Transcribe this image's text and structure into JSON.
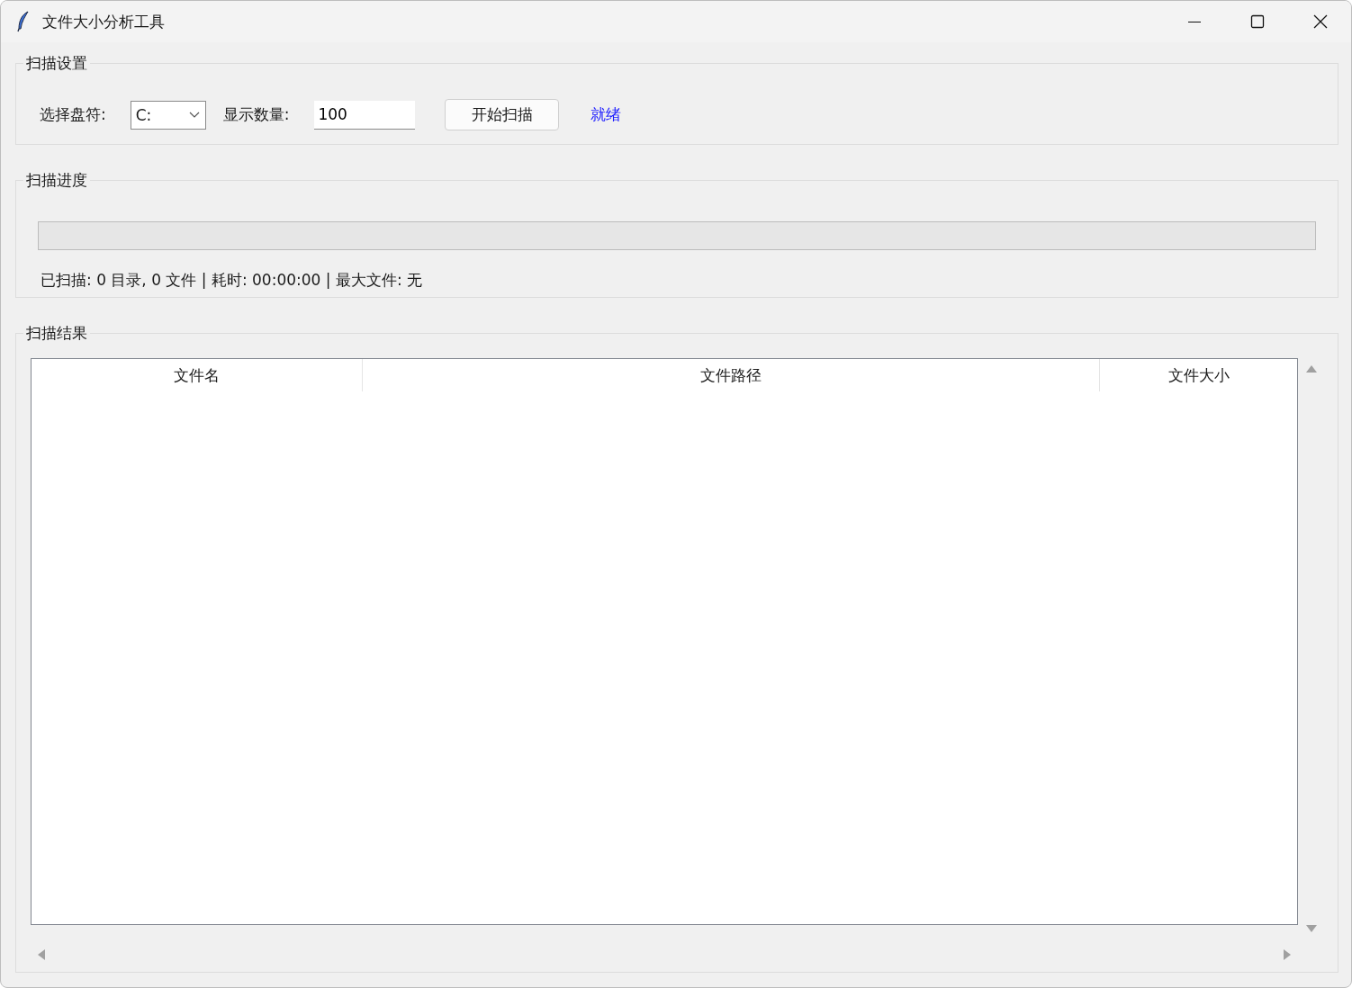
{
  "window": {
    "title": "文件大小分析工具"
  },
  "settings": {
    "legend": "扫描设置",
    "drive_label": "选择盘符:",
    "drive_value": "C:",
    "count_label": "显示数量:",
    "count_value": "100",
    "start_button": "开始扫描",
    "status": "就绪"
  },
  "progress": {
    "legend": "扫描进度",
    "level": 0,
    "summary": "已扫描: 0 目录, 0 文件 | 耗时: 00:00:00 | 最大文件: 无"
  },
  "results": {
    "legend": "扫描结果",
    "columns": [
      "文件名",
      "文件路径",
      "文件大小"
    ]
  }
}
